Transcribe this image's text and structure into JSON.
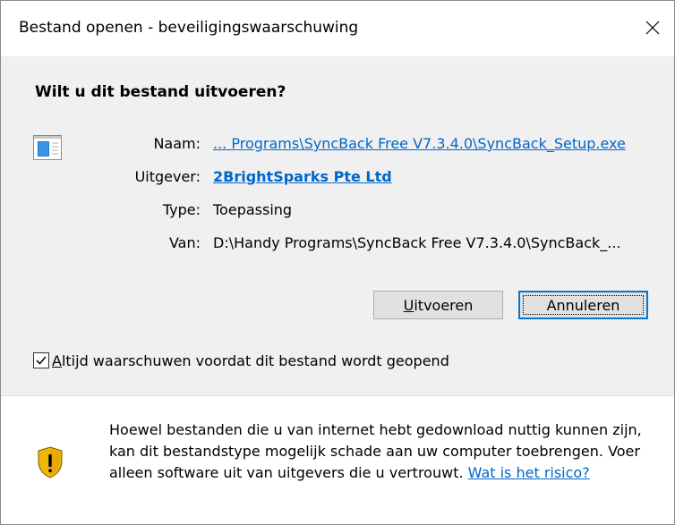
{
  "window": {
    "title": "Bestand openen - beveiligingswaarschuwing"
  },
  "dialog": {
    "question": "Wilt u dit bestand uitvoeren?",
    "fields": [
      {
        "label": "Naam:",
        "value": "... Programs\\SyncBack Free V7.3.4.0\\SyncBack_Setup.exe"
      },
      {
        "label": "Uitgever:",
        "value": "2BrightSparks Pte Ltd"
      },
      {
        "label": "Type:",
        "value": "Toepassing"
      },
      {
        "label": "Van:",
        "value": "D:\\Handy Programs\\SyncBack Free V7.3.4.0\\SyncBack_..."
      }
    ],
    "buttons": {
      "run_label_pre": "",
      "run_label_accel": "U",
      "run_label_post": "itvoeren",
      "cancel_label": "Annuleren"
    },
    "checkbox": {
      "label_accel": "A",
      "label_rest": "ltijd waarschuwen voordat dit bestand wordt geopend",
      "checked": true
    }
  },
  "footer": {
    "warning_text": "Hoewel bestanden die u van internet hebt gedownload nuttig kunnen zijn, kan dit bestandstype mogelijk schade aan uw computer toebrengen. Voer alleen software uit van uitgevers die u vertrouwt.",
    "risk_link": "Wat is het risico?"
  },
  "colors": {
    "link": "#0066cc",
    "focus_border": "#0078d7",
    "content_bg": "#f0f0f0",
    "shield_gold": "#f2b705"
  }
}
